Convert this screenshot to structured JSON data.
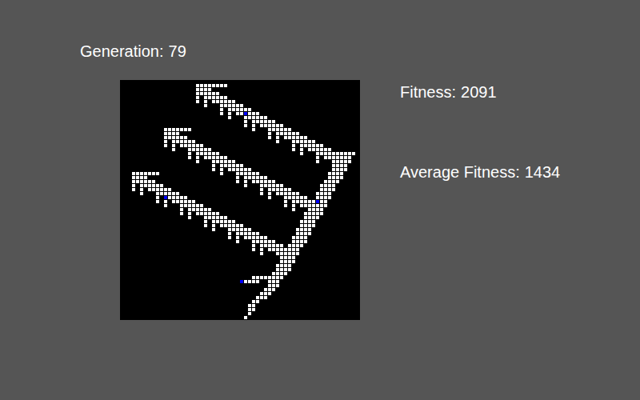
{
  "generation": {
    "label": "Generation:",
    "value": "79"
  },
  "fitness": {
    "label": "Fitness:",
    "value": "2091"
  },
  "average_fitness": {
    "label": "Average Fitness:",
    "value": "1434"
  },
  "grid": {
    "white_runs": [
      [],
      [
        [
          19,
          26
        ]
      ],
      [
        [
          19,
          22
        ]
      ],
      [
        [
          19,
          24
        ]
      ],
      [
        [
          19,
          19
        ],
        [
          21,
          26
        ]
      ],
      [
        [
          19,
          19
        ],
        [
          21,
          21
        ],
        [
          23,
          28
        ]
      ],
      [
        [
          21,
          21
        ],
        [
          25,
          30
        ]
      ],
      [
        [
          25,
          25
        ],
        [
          27,
          32
        ]
      ],
      [
        [
          25,
          25
        ],
        [
          27,
          27
        ],
        [
          29,
          34
        ]
      ],
      [
        [
          27,
          27
        ],
        [
          31,
          36
        ]
      ],
      [
        [
          31,
          31
        ],
        [
          33,
          38
        ]
      ],
      [
        [
          31,
          31
        ],
        [
          33,
          33
        ],
        [
          35,
          40
        ]
      ],
      [
        [
          11,
          17
        ],
        [
          33,
          33
        ],
        [
          37,
          42
        ]
      ],
      [
        [
          11,
          14
        ],
        [
          37,
          37
        ],
        [
          39,
          44
        ]
      ],
      [
        [
          11,
          16
        ],
        [
          37,
          37
        ],
        [
          39,
          39
        ],
        [
          41,
          46
        ]
      ],
      [
        [
          11,
          11
        ],
        [
          13,
          18
        ],
        [
          39,
          39
        ],
        [
          43,
          48
        ]
      ],
      [
        [
          11,
          11
        ],
        [
          13,
          13
        ],
        [
          15,
          20
        ],
        [
          43,
          43
        ],
        [
          45,
          50
        ]
      ],
      [
        [
          13,
          13
        ],
        [
          17,
          22
        ],
        [
          43,
          43
        ],
        [
          45,
          45
        ],
        [
          47,
          52
        ]
      ],
      [
        [
          17,
          17
        ],
        [
          19,
          24
        ],
        [
          45,
          45
        ],
        [
          49,
          58
        ]
      ],
      [
        [
          17,
          17
        ],
        [
          19,
          19
        ],
        [
          21,
          26
        ],
        [
          49,
          49
        ],
        [
          51,
          57
        ]
      ],
      [
        [
          19,
          19
        ],
        [
          23,
          28
        ],
        [
          49,
          49
        ],
        [
          53,
          57
        ]
      ],
      [
        [
          23,
          23
        ],
        [
          25,
          30
        ],
        [
          53,
          56
        ]
      ],
      [
        [
          23,
          23
        ],
        [
          25,
          25
        ],
        [
          27,
          32
        ],
        [
          53,
          56
        ]
      ],
      [
        [
          3,
          9
        ],
        [
          25,
          25
        ],
        [
          29,
          34
        ],
        [
          52,
          55
        ]
      ],
      [
        [
          3,
          6
        ],
        [
          29,
          29
        ],
        [
          31,
          36
        ],
        [
          52,
          55
        ]
      ],
      [
        [
          3,
          8
        ],
        [
          29,
          29
        ],
        [
          31,
          31
        ],
        [
          33,
          38
        ],
        [
          51,
          54
        ]
      ],
      [
        [
          3,
          3
        ],
        [
          5,
          10
        ],
        [
          31,
          31
        ],
        [
          35,
          40
        ],
        [
          50,
          53
        ]
      ],
      [
        [
          3,
          3
        ],
        [
          5,
          5
        ],
        [
          7,
          12
        ],
        [
          35,
          35
        ],
        [
          37,
          42
        ],
        [
          50,
          53
        ]
      ],
      [
        [
          5,
          5
        ],
        [
          9,
          14
        ],
        [
          35,
          35
        ],
        [
          37,
          37
        ],
        [
          39,
          44
        ],
        [
          49,
          52
        ]
      ],
      [
        [
          9,
          9
        ],
        [
          11,
          16
        ],
        [
          37,
          37
        ],
        [
          41,
          46
        ],
        [
          49,
          52
        ]
      ],
      [
        [
          9,
          9
        ],
        [
          11,
          11
        ],
        [
          13,
          18
        ],
        [
          41,
          41
        ],
        [
          43,
          51
        ]
      ],
      [
        [
          11,
          11
        ],
        [
          15,
          20
        ],
        [
          41,
          41
        ],
        [
          43,
          43
        ],
        [
          45,
          51
        ]
      ],
      [
        [
          15,
          15
        ],
        [
          17,
          22
        ],
        [
          43,
          43
        ],
        [
          47,
          50
        ]
      ],
      [
        [
          15,
          15
        ],
        [
          17,
          17
        ],
        [
          19,
          24
        ],
        [
          46,
          50
        ]
      ],
      [
        [
          17,
          17
        ],
        [
          21,
          26
        ],
        [
          46,
          49
        ]
      ],
      [
        [
          21,
          21
        ],
        [
          23,
          28
        ],
        [
          45,
          48
        ]
      ],
      [
        [
          21,
          21
        ],
        [
          23,
          23
        ],
        [
          25,
          30
        ],
        [
          45,
          48
        ]
      ],
      [
        [
          23,
          23
        ],
        [
          27,
          32
        ],
        [
          44,
          47
        ]
      ],
      [
        [
          27,
          27
        ],
        [
          29,
          34
        ],
        [
          44,
          47
        ]
      ],
      [
        [
          27,
          27
        ],
        [
          29,
          29
        ],
        [
          31,
          36
        ],
        [
          43,
          46
        ]
      ],
      [
        [
          29,
          29
        ],
        [
          33,
          38
        ],
        [
          43,
          46
        ]
      ],
      [
        [
          33,
          33
        ],
        [
          35,
          40
        ],
        [
          42,
          45
        ]
      ],
      [
        [
          33,
          33
        ],
        [
          35,
          35
        ],
        [
          37,
          44
        ]
      ],
      [
        [
          35,
          35
        ],
        [
          39,
          44
        ]
      ],
      [
        [
          40,
          43
        ]
      ],
      [
        [
          40,
          43
        ]
      ],
      [
        [
          39,
          42
        ]
      ],
      [
        [
          39,
          42
        ]
      ],
      [
        [
          38,
          41
        ]
      ],
      [
        [
          33,
          40
        ]
      ],
      [
        [
          30,
          34
        ],
        [
          37,
          39
        ]
      ],
      [
        [
          37,
          39
        ]
      ],
      [
        [
          36,
          38
        ]
      ],
      [
        [
          35,
          37
        ]
      ],
      [
        [
          34,
          36
        ]
      ],
      [
        [
          33,
          34
        ]
      ],
      [
        [
          32,
          33
        ]
      ],
      [
        [
          32,
          33
        ]
      ],
      [
        [
          32,
          32
        ]
      ],
      [
        [
          31,
          31
        ]
      ]
    ],
    "blue_cells": [
      [
        31,
        8
      ],
      [
        49,
        30
      ],
      [
        11,
        29
      ],
      [
        30,
        50
      ]
    ]
  }
}
